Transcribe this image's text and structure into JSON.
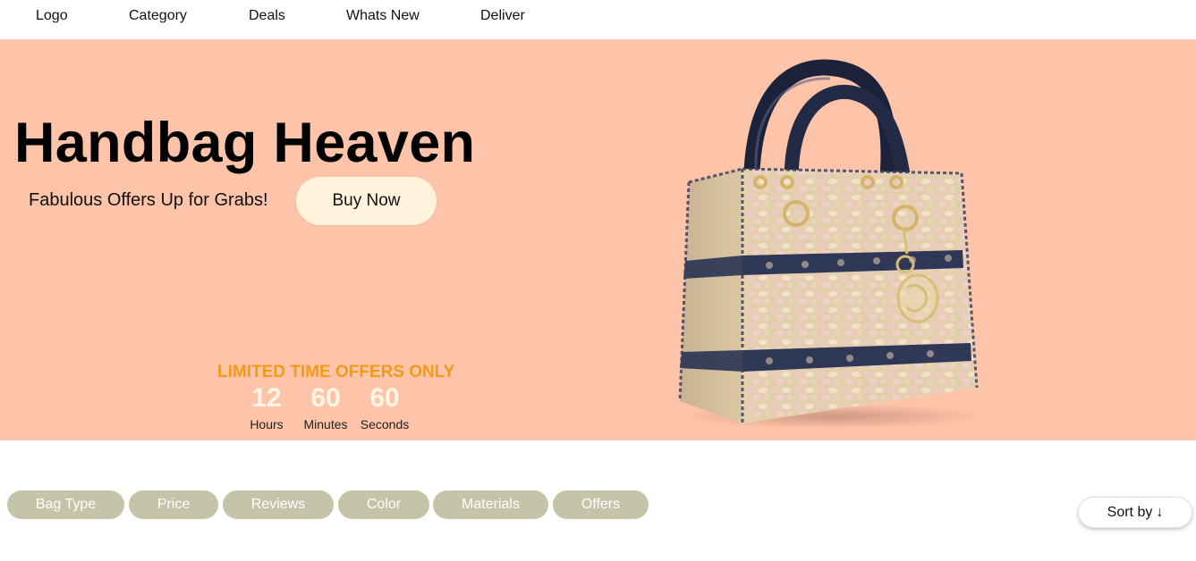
{
  "nav": {
    "items": [
      {
        "label": "Logo"
      },
      {
        "label": "Category"
      },
      {
        "label": "Deals"
      },
      {
        "label": "Whats New"
      },
      {
        "label": "Deliver"
      }
    ]
  },
  "hero": {
    "title": "Handbag Heaven",
    "subtitle": "Fabulous Offers Up for Grabs!",
    "cta_label": "Buy Now",
    "background_color": "#fec4aa",
    "offer": {
      "title": "LIMITED TIME OFFERS ONLY",
      "countdown": [
        {
          "value": "12",
          "unit": "Hours"
        },
        {
          "value": "60",
          "unit": "Minutes"
        },
        {
          "value": "60",
          "unit": "Seconds"
        }
      ]
    },
    "image": {
      "icon": "handbag-image"
    }
  },
  "filters": {
    "items": [
      {
        "label": "Bag Type"
      },
      {
        "label": "Price"
      },
      {
        "label": "Reviews"
      },
      {
        "label": "Color"
      },
      {
        "label": "Materials"
      },
      {
        "label": "Offers"
      }
    ],
    "pill_color": "#c5c4a8"
  },
  "sort": {
    "label": "Sort by",
    "arrow": "↓"
  }
}
